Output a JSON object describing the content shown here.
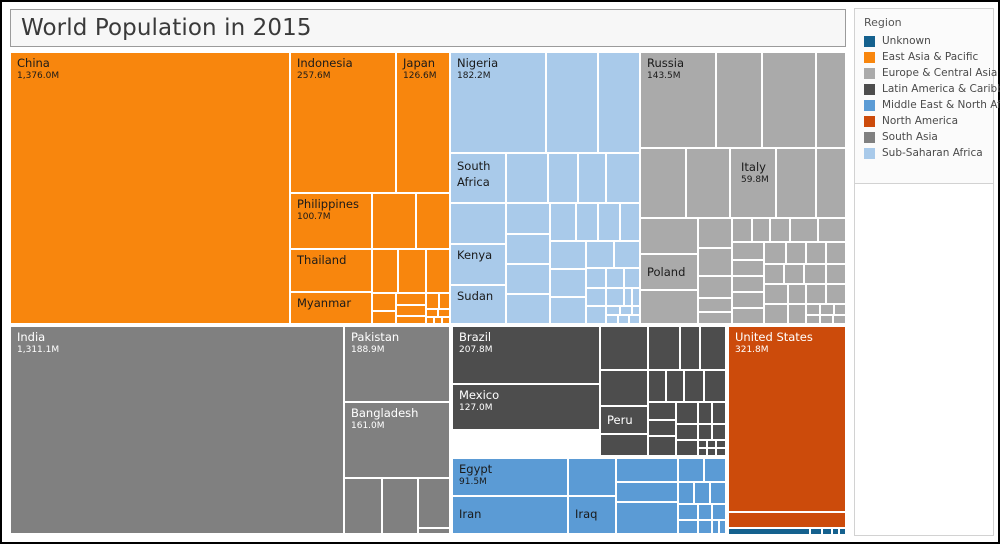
{
  "title": "World Population in 2015",
  "legend": {
    "heading": "Region",
    "items": [
      {
        "label": "Unknown",
        "color": "#15618E"
      },
      {
        "label": "East Asia & Pacific",
        "color": "#F8860D"
      },
      {
        "label": "Europe & Central Asia",
        "color": "#AAAAAA"
      },
      {
        "label": "Latin America & Caribb..",
        "color": "#4D4D4D"
      },
      {
        "label": "Middle East & North Af..",
        "color": "#5B9BD5"
      },
      {
        "label": "North America",
        "color": "#CC4B0B"
      },
      {
        "label": "South Asia",
        "color": "#808080"
      },
      {
        "label": "Sub-Saharan Africa",
        "color": "#A9CAEA"
      }
    ]
  },
  "chart_data": {
    "type": "treemap",
    "title": "World Population in 2015",
    "value_unit": "Millions of people",
    "legend_position": "right",
    "group_field": "Region",
    "size_field": "Population",
    "labelled_countries": [
      {
        "name": "China",
        "value": 1376.0,
        "label": "1,376.0M",
        "region": "East Asia & Pacific"
      },
      {
        "name": "Indonesia",
        "value": 257.6,
        "label": "257.6M",
        "region": "East Asia & Pacific"
      },
      {
        "name": "Japan",
        "value": 126.6,
        "label": "126.6M",
        "region": "East Asia & Pacific"
      },
      {
        "name": "Philippines",
        "value": 100.7,
        "label": "100.7M",
        "region": "East Asia & Pacific"
      },
      {
        "name": "Thailand",
        "value": 68.0,
        "label": "",
        "region": "East Asia & Pacific"
      },
      {
        "name": "Myanmar",
        "value": 53.9,
        "label": "",
        "region": "East Asia & Pacific"
      },
      {
        "name": "Nigeria",
        "value": 182.2,
        "label": "182.2M",
        "region": "Sub-Saharan Africa"
      },
      {
        "name": "South Africa",
        "value": 55.0,
        "label": "",
        "region": "Sub-Saharan Africa"
      },
      {
        "name": "Kenya",
        "value": 46.1,
        "label": "",
        "region": "Sub-Saharan Africa"
      },
      {
        "name": "Sudan",
        "value": 40.2,
        "label": "",
        "region": "Sub-Saharan Africa"
      },
      {
        "name": "Russia",
        "value": 143.5,
        "label": "143.5M",
        "region": "Europe & Central Asia"
      },
      {
        "name": "Italy",
        "value": 59.8,
        "label": "59.8M",
        "region": "Europe & Central Asia"
      },
      {
        "name": "Poland",
        "value": 38.0,
        "label": "",
        "region": "Europe & Central Asia"
      },
      {
        "name": "India",
        "value": 1311.1,
        "label": "1,311.1M",
        "region": "South Asia"
      },
      {
        "name": "Pakistan",
        "value": 188.9,
        "label": "188.9M",
        "region": "South Asia"
      },
      {
        "name": "Bangladesh",
        "value": 161.0,
        "label": "161.0M",
        "region": "South Asia"
      },
      {
        "name": "Brazil",
        "value": 207.8,
        "label": "207.8M",
        "region": "Latin America & Caribbean"
      },
      {
        "name": "Mexico",
        "value": 127.0,
        "label": "127.0M",
        "region": "Latin America & Caribbean"
      },
      {
        "name": "Peru",
        "value": 31.4,
        "label": "",
        "region": "Latin America & Caribbean"
      },
      {
        "name": "Egypt",
        "value": 91.5,
        "label": "91.5M",
        "region": "Middle East & North Africa"
      },
      {
        "name": "Iran",
        "value": 79.1,
        "label": "",
        "region": "Middle East & North Africa"
      },
      {
        "name": "Iraq",
        "value": 36.4,
        "label": "",
        "region": "Middle East & North Africa"
      },
      {
        "name": "United States",
        "value": 321.8,
        "label": "321.8M",
        "region": "North America"
      }
    ]
  },
  "tiles": {
    "china": {
      "name": "China",
      "value": "1,376.0M"
    },
    "indonesia": {
      "name": "Indonesia",
      "value": "257.6M"
    },
    "japan": {
      "name": "Japan",
      "value": "126.6M"
    },
    "philippines": {
      "name": "Philippines",
      "value": "100.7M"
    },
    "thailand": {
      "name": "Thailand",
      "value": ""
    },
    "myanmar": {
      "name": "Myanmar",
      "value": ""
    },
    "nigeria": {
      "name": "Nigeria",
      "value": "182.2M"
    },
    "south_africa": {
      "name": "South Africa",
      "value": ""
    },
    "kenya": {
      "name": "Kenya",
      "value": ""
    },
    "sudan": {
      "name": "Sudan",
      "value": ""
    },
    "russia": {
      "name": "Russia",
      "value": "143.5M"
    },
    "italy": {
      "name": "Italy",
      "value": "59.8M"
    },
    "poland": {
      "name": "Poland",
      "value": ""
    },
    "india": {
      "name": "India",
      "value": "1,311.1M"
    },
    "pakistan": {
      "name": "Pakistan",
      "value": "188.9M"
    },
    "bangladesh": {
      "name": "Bangladesh",
      "value": "161.0M"
    },
    "brazil": {
      "name": "Brazil",
      "value": "207.8M"
    },
    "mexico": {
      "name": "Mexico",
      "value": "127.0M"
    },
    "peru": {
      "name": "Peru",
      "value": ""
    },
    "egypt": {
      "name": "Egypt",
      "value": "91.5M"
    },
    "iran": {
      "name": "Iran",
      "value": ""
    },
    "iraq": {
      "name": "Iraq",
      "value": ""
    },
    "united_states": {
      "name": "United States",
      "value": "321.8M"
    }
  },
  "colors": {
    "unknown": "#15618E",
    "east_asia": "#F8860D",
    "europe": "#AAAAAA",
    "latin_america": "#4D4D4D",
    "middle_east": "#5B9BD5",
    "north_america": "#CC4B0B",
    "south_asia": "#808080",
    "subsaharan": "#A9CAEA"
  }
}
